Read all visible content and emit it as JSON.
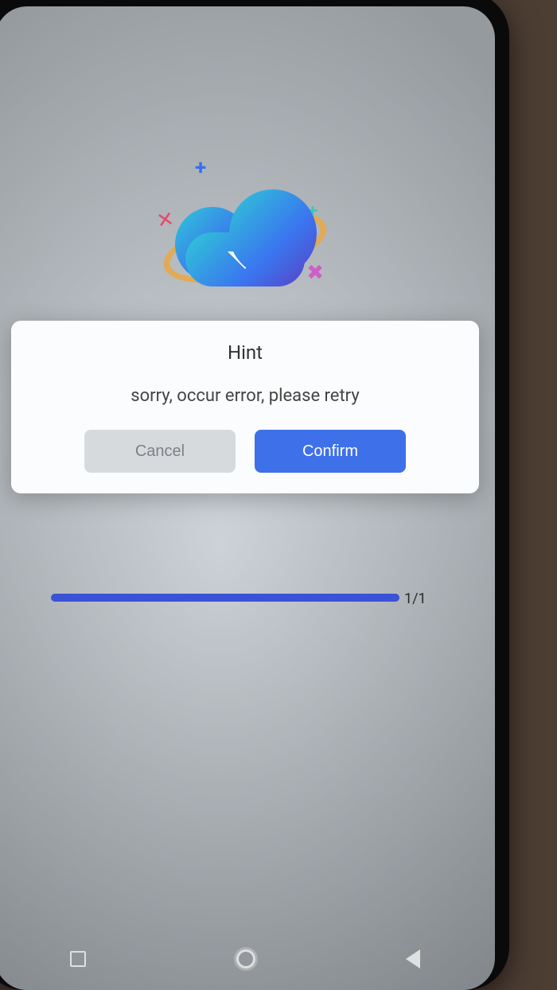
{
  "dialog": {
    "title": "Hint",
    "message": "sorry, occur error, please retry",
    "cancel_label": "Cancel",
    "confirm_label": "Confirm"
  },
  "progress": {
    "label": "1/1",
    "percent": 100
  },
  "icons": {
    "app_logo": "cloud-download-icon",
    "nav_recent": "recent-apps-icon",
    "nav_home": "home-icon",
    "nav_back": "back-icon"
  }
}
